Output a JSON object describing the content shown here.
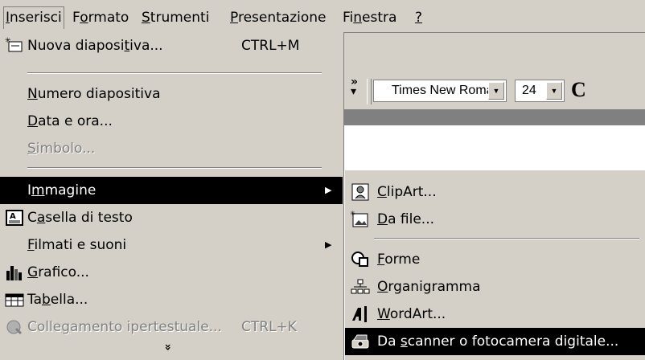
{
  "menubar": [
    {
      "pre": "",
      "ul": "I",
      "post": "nserisci"
    },
    {
      "pre": "F",
      "ul": "o",
      "post": "rmato"
    },
    {
      "pre": "",
      "ul": "S",
      "post": "trumenti"
    },
    {
      "pre": "",
      "ul": "P",
      "post": "resentazione"
    },
    {
      "pre": "Fi",
      "ul": "n",
      "post": "estra"
    },
    {
      "pre": "",
      "ul": "?",
      "post": ""
    }
  ],
  "toolbar": {
    "font_name": "Times New Roman",
    "font_size": "24",
    "bold_glyph": "C"
  },
  "menu": {
    "items": [
      {
        "pre": "Nuova diaposi",
        "ul": "t",
        "post": "iva...",
        "shortcut": "CTRL+M"
      },
      {
        "pre": "",
        "ul": "N",
        "post": "umero diapositiva"
      },
      {
        "pre": "",
        "ul": "D",
        "post": "ata e ora..."
      },
      {
        "pre": "",
        "ul": "S",
        "post": "imbolo..."
      },
      {
        "pre": "I",
        "ul": "m",
        "post": "magine"
      },
      {
        "pre": "C",
        "ul": "a",
        "post": "sella di testo"
      },
      {
        "pre": "",
        "ul": "F",
        "post": "ilmati e suoni"
      },
      {
        "pre": "",
        "ul": "G",
        "post": "rafico..."
      },
      {
        "pre": "Ta",
        "ul": "b",
        "post": "ella..."
      },
      {
        "pre": "Colle",
        "ul": "g",
        "post": "amento ipertestuale...",
        "shortcut": "CTRL+K"
      }
    ],
    "expand_glyph": "»"
  },
  "submenu": {
    "items": [
      {
        "pre": "",
        "ul": "C",
        "post": "lipArt..."
      },
      {
        "pre": "",
        "ul": "D",
        "post": "a file..."
      },
      {
        "pre": "",
        "ul": "F",
        "post": "orme"
      },
      {
        "pre": "",
        "ul": "O",
        "post": "rganigramma"
      },
      {
        "pre": "",
        "ul": "W",
        "post": "ordArt..."
      },
      {
        "pre": "Da ",
        "ul": "s",
        "post": "canner o fotocamera digitale..."
      }
    ]
  },
  "colors": {
    "menu_bg": "#d4d0c8",
    "highlight": "#000000",
    "disabled": "#808080"
  }
}
